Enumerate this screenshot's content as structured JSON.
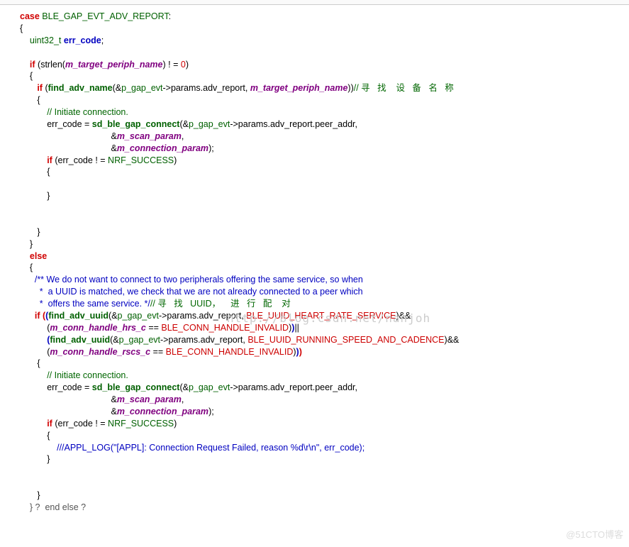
{
  "code": {
    "case_kw": "case",
    "case_id": "BLE_GAP_EVT_ADV_REPORT",
    "uint32": "uint32_t",
    "err_decl": "err_code",
    "if_kw": "if",
    "else_kw": "else",
    "strlen": "strlen",
    "target_name": "m_target_periph_name",
    "neq_zero": " ! = ",
    "zero": "0",
    "find_adv_name": "find_adv_name",
    "pgap": "p_gap_evt",
    "params_adv_report": "->params.adv_report",
    "cmt_search_name": "// 寻   找    设   备   名   称",
    "cmt_initiate": "// Initiate connection.",
    "err_code": "err_code",
    "eq": " = ",
    "sd_connect": "sd_ble_gap_connect",
    "peer_addr": "->params.adv_report.peer_addr",
    "scan_param": "m_scan_param",
    "conn_param": "m_connection_param",
    "nrf_success": "NRF_SUCCESS",
    "block_cmt1": "/** We do not want to connect to two peripherals offering the same service, so when",
    "block_cmt2": " *  a UUID is matched, we check that we are not already connected to a peer which",
    "block_cmt3": " *  offers the same service. */",
    "cmt_uuid": "// 寻   找   UUID，    进   行   配    对",
    "find_adv_uuid": "find_adv_uuid",
    "ble_uuid_hrs": "BLE_UUID_HEART_RATE_SERVICE",
    "hrs_handle": "m_conn_handle_hrs_c",
    "conn_invalid": "BLE_CONN_HANDLE_INVALID",
    "ble_uuid_rscs": "BLE_UUID_RUNNING_SPEED_AND_CADENCE",
    "rscs_handle": "m_conn_handle_rscs_c",
    "appl_log": "///APPL_LOG(\"[APPL]: Connection Request Failed, reason %d\\r\\n\", err_code);",
    "end_else": "} ?  end else ?",
    "and": "&&",
    "or": "||",
    "eqeq": " == "
  },
  "watermarks": {
    "csdn": "http://blog.csdn.net/nanjoh",
    "cto": "@51CTO博客"
  }
}
